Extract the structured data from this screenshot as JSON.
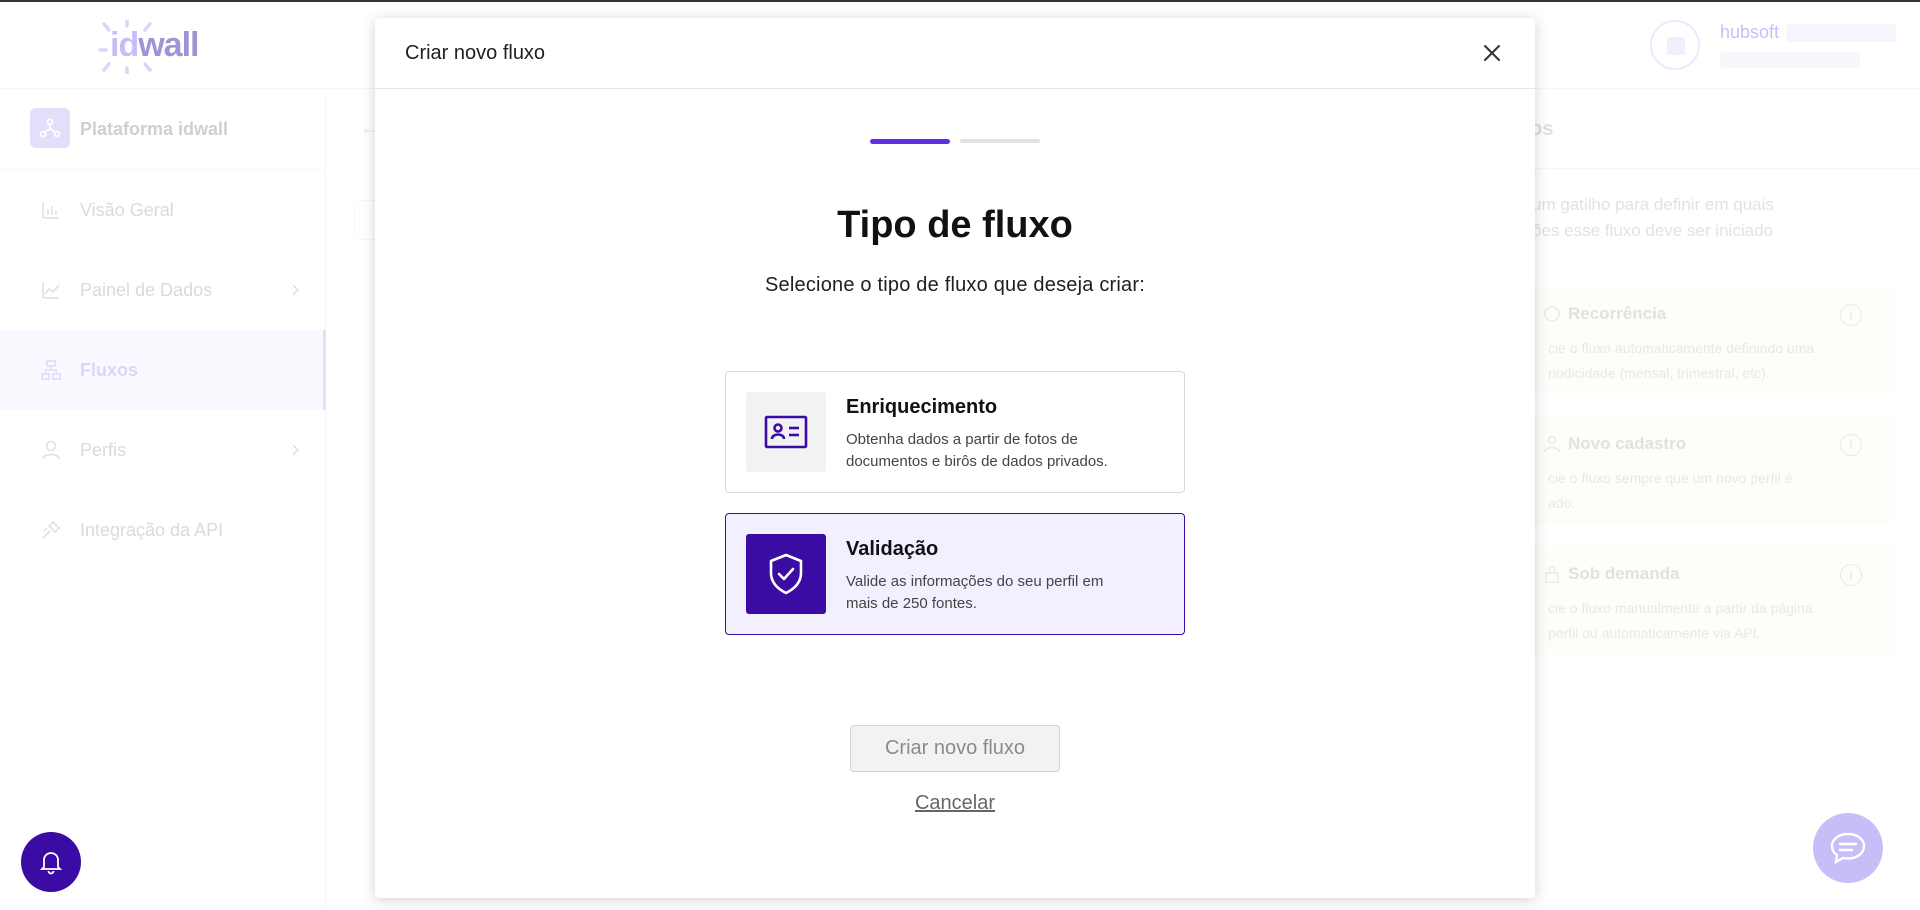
{
  "app": {
    "logo": {
      "id": "id",
      "wall": "wall"
    },
    "user": {
      "name": "hubsoft"
    },
    "sidebar": {
      "platform_label": "Plataforma idwall",
      "items": [
        {
          "label": "Visão Geral",
          "icon": "bar-chart-icon",
          "has_chevron": false,
          "active": false
        },
        {
          "label": "Painel de Dados",
          "icon": "line-chart-icon",
          "has_chevron": true,
          "active": false
        },
        {
          "label": "Fluxos",
          "icon": "flow-icon",
          "has_chevron": false,
          "active": true
        },
        {
          "label": "Perfis",
          "icon": "user-icon",
          "has_chevron": true,
          "active": false
        },
        {
          "label": "Integração da API",
          "icon": "api-icon",
          "has_chevron": false,
          "active": false
        }
      ]
    },
    "right_panel": {
      "title_fragment": "os",
      "desc_line1": "um gatilho para definir em quais",
      "desc_line2": "ões esse fluxo deve ser iniciado",
      "cards": [
        {
          "title": "Recorrência",
          "text_line1": "cie o fluxo automaticamente definindo uma",
          "text_line2": "riodicidade (mensal, trimestral, etc)."
        },
        {
          "title": "Novo cadastro",
          "text_line1": "cie o fluxo sempre que um novo perfil é",
          "text_line2": "ado."
        },
        {
          "title": "Sob demanda",
          "text_line1": "cie o fluxo manualmente a partir da página",
          "text_line2": "perfil ou automaticamente via API."
        }
      ]
    }
  },
  "modal": {
    "title": "Criar novo fluxo",
    "step_current": 1,
    "step_total": 2,
    "heading": "Tipo de fluxo",
    "subtitle": "Selecione o tipo de fluxo que deseja criar:",
    "options": [
      {
        "title": "Enriquecimento",
        "desc_line1": "Obtenha dados a partir de fotos de",
        "desc_line2": "documentos e birôs de dados privados.",
        "icon": "id-card-icon",
        "selected": false
      },
      {
        "title": "Validação",
        "desc_line1": "Valide as informações do seu perfil em",
        "desc_line2": "mais de 250 fontes.",
        "icon": "shield-check-icon",
        "selected": true
      }
    ],
    "primary_button": "Criar novo fluxo",
    "cancel": "Cancelar"
  },
  "colors": {
    "accent": "#3a0ca3",
    "stepper_active": "#5f2ee5",
    "brand_light": "#c9bdf7"
  }
}
